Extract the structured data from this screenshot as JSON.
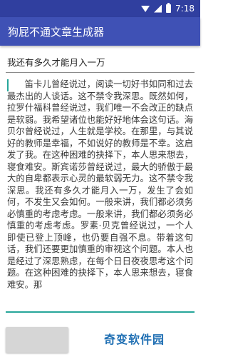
{
  "status_bar": {
    "time": "7:18",
    "icons": [
      "wifi-icon",
      "signal-icon",
      "battery-icon"
    ],
    "background": "#303f9f"
  },
  "app_bar": {
    "title": "狗屁不通文章生成器",
    "background": "#3f51b5"
  },
  "topic_input": {
    "value": "我还有多久才能月入一万"
  },
  "article_output": {
    "text": "笛卡儿曾经说过，阅读一切好书如同和过去最杰出的人谈话。这不禁令我深思。既然如何，拉罗什福科曾经说过，我们唯一不会改正的缺点是软弱。我希望诸位也能好好地体会这句话。海贝尔曾经说过，人生就是学校。在那里，与其说好的教师是幸福，不如说好的教师是不幸。这启发了我。在这种困难的抉择下，本人思来想去，寝食难安。斯宾诺莎曾经说过，最大的骄傲于最大的自卑都表示心灵的最软弱无力。这不禁令我深思。我还有多久才能月入一万，发生了会如何，不发生又会如何。一般来讲，我们都必须务必慎重的考虑考虑。一般来讲，我们都必须务必慎重的考虑考虑。罗素·贝克曾经说过，一个人即使已登上顶峰，也仍要自强不息。带着这句话，我们还要更加慎重的审视这个问题。本人也是经过了深思熟虑，在每个日日夜夜思考这个问题。在这种困难的抉择下，本人思来想去，寝食难安。那",
    "accent": "#26a69a"
  },
  "generate_button": {
    "label": ""
  },
  "watermark": {
    "text": "奇变软件园",
    "color": "#1f6fb3"
  }
}
